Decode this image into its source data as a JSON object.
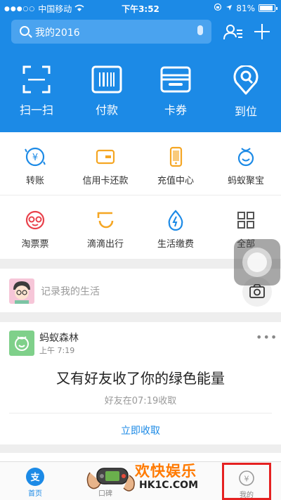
{
  "status_bar": {
    "carrier": "中国移动",
    "time": "下午3:52",
    "battery": "81%"
  },
  "search": {
    "placeholder": "我的2016"
  },
  "top_actions": [
    {
      "label": "扫一扫",
      "icon": "scan-icon"
    },
    {
      "label": "付款",
      "icon": "barcode-icon"
    },
    {
      "label": "卡券",
      "icon": "wallet-icon"
    },
    {
      "label": "到位",
      "icon": "location-icon"
    }
  ],
  "services": [
    {
      "label": "转账",
      "icon": "transfer-icon"
    },
    {
      "label": "信用卡还款",
      "icon": "credit-card-icon"
    },
    {
      "label": "充值中心",
      "icon": "phone-topup-icon"
    },
    {
      "label": "蚂蚁聚宝",
      "icon": "ant-fortune-icon"
    },
    {
      "label": "淘票票",
      "icon": "movie-ticket-icon"
    },
    {
      "label": "滴滴出行",
      "icon": "didi-icon"
    },
    {
      "label": "生活缴费",
      "icon": "utility-payment-icon"
    },
    {
      "label": "全部",
      "icon": "grid-all-icon"
    }
  ],
  "life_record": {
    "text": "记录我的生活"
  },
  "feed_card": {
    "source": "蚂蚁森林",
    "time": "上午 7:19",
    "headline": "又有好友收了你的绿色能量",
    "sub": "好友在07:19收取",
    "action": "立即收取"
  },
  "tabs": [
    {
      "label": "首页",
      "icon": "home-icon"
    },
    {
      "label": "口碑",
      "icon": "koubei-icon"
    },
    {
      "label": "",
      "icon": "friends-icon"
    },
    {
      "label": "我的",
      "icon": "yuan-icon"
    }
  ],
  "watermark": {
    "line1": "欢快娱乐",
    "line2": "HK1C.COM"
  },
  "colors": {
    "brand_blue": "#1c8ae6",
    "icon_orange": "#f5a623",
    "highlight_red": "#e52121"
  }
}
